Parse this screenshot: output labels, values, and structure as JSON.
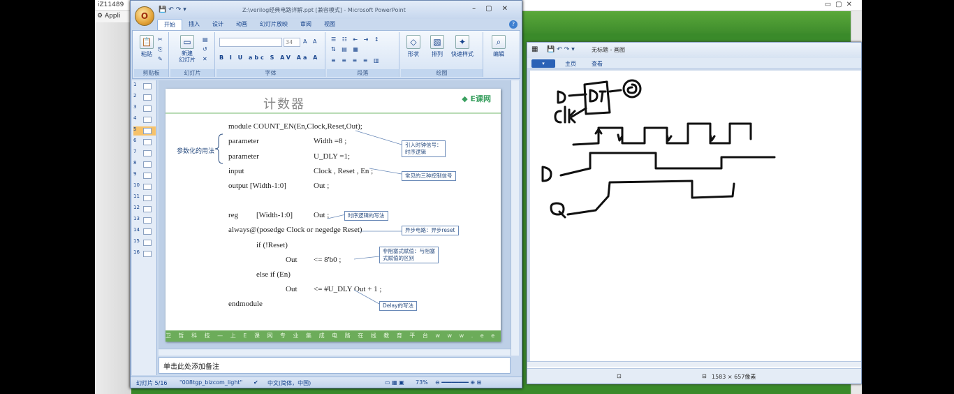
{
  "remote": {
    "title": "iZ11489",
    "apps_label": "Appli"
  },
  "ppt": {
    "caption": "Z:\\verilog经典电路详解.ppt [兼容模式] - Microsoft PowerPoint",
    "office_button": "O",
    "tabs": [
      "开始",
      "插入",
      "设计",
      "动画",
      "幻灯片放映",
      "审阅",
      "视图"
    ],
    "active_tab": "开始",
    "help": "?",
    "groups": {
      "clipboard": "剪贴板",
      "slides": "幻灯片",
      "font": "字体",
      "paragraph": "段落",
      "drawing": "绘图",
      "editing": "编辑"
    },
    "buttons": {
      "paste": "粘贴",
      "new_slide": "新建\n幻灯片",
      "shape": "形状",
      "arrange": "排列",
      "quick_styles": "快速样式",
      "edit": "编辑",
      "font_size": "34"
    },
    "slide_numbers": [
      "1",
      "2",
      "3",
      "4",
      "5",
      "6",
      "7",
      "8",
      "9",
      "10",
      "11",
      "12",
      "13",
      "14",
      "15",
      "16"
    ],
    "selected_slide": "5",
    "slide": {
      "title": "计数器",
      "logo": "E课网",
      "brace_label": "参数化的用法",
      "footer": "卫 哲 科 技 — 上 E 课 网 专 业 集 成 电 路 在 线 教 育 平 台   w w w . e e c o u r s e . c o m",
      "code": [
        "module COUNT_EN(En,Clock,Reset,Out);",
        "parameter",
        "Width   =8 ;",
        "parameter",
        "U_DLY =1;",
        "input",
        "Clock , Reset , En ;",
        "output   [Width-1:0]",
        "Out ;",
        "reg",
        "[Width-1:0]",
        "Out ;",
        "always@(posedge Clock or negedge Reset)",
        "if (!Reset)",
        "Out",
        "<= 8'b0 ;",
        "else if (En)",
        "Out",
        "<= #U_DLY Out + 1 ;",
        "endmodule"
      ],
      "notes": [
        "引入时钟信号：\n时序逻辑",
        "常见的三种控制信号",
        "时序逻辑的写法",
        "异步电路：异步reset",
        "非阻塞式赋值：与阻塞\n式赋值的区别",
        "Delay的写法"
      ]
    },
    "notes_placeholder": "单击此处添加备注",
    "status": {
      "slide": "幻灯片 5/16",
      "theme": "\"008tgp_bizcom_light\"",
      "language": "中文(简体，中国)",
      "zoom": "73%"
    }
  },
  "paint": {
    "caption": "无标题 - 画图",
    "menu": "▾",
    "tabs": [
      "主页",
      "查看"
    ],
    "status_size": "1583 × 657像素"
  }
}
